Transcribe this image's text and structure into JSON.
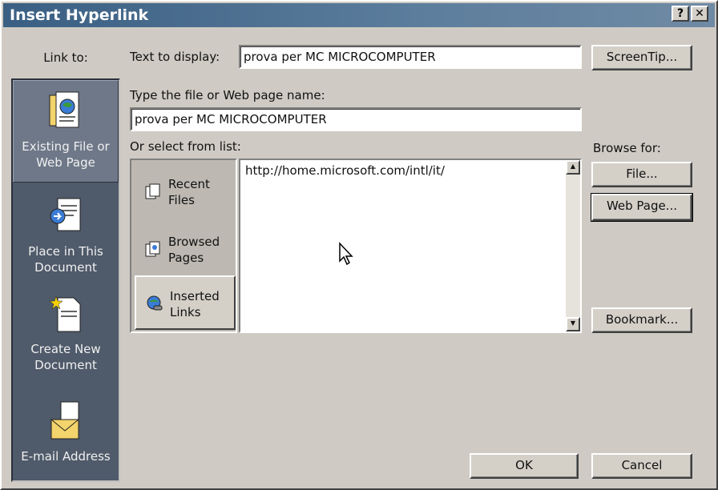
{
  "dialog": {
    "title": "Insert Hyperlink",
    "help_label": "?",
    "close_label": "✕"
  },
  "link_to": {
    "label": "Link to:",
    "places": [
      {
        "label_line1": "Existing File or",
        "label_line2": "Web Page",
        "icon": "existing-file-icon",
        "active": true
      },
      {
        "label_line1": "Place in This",
        "label_line2": "Document",
        "icon": "place-in-document-icon",
        "active": false
      },
      {
        "label_line1": "Create New",
        "label_line2": "Document",
        "icon": "create-new-document-icon",
        "active": false
      },
      {
        "label_line1": "E-mail Address",
        "label_line2": "",
        "icon": "email-icon",
        "active": false
      }
    ]
  },
  "text_to_display": {
    "label": "Text to display:",
    "value": "prova per MC MICROCOMPUTER"
  },
  "screentip_button": "ScreenTip...",
  "file_name": {
    "label": "Type the file or Web page name:",
    "value": "prova per MC MICROCOMPUTER"
  },
  "select_list": {
    "label": "Or select from list:",
    "frames": [
      {
        "line1": "Recent",
        "line2": "Files",
        "icon": "recent-files-icon",
        "selected": false
      },
      {
        "line1": "Browsed",
        "line2": "Pages",
        "icon": "browsed-pages-icon",
        "selected": false
      },
      {
        "line1": "Inserted",
        "line2": "Links",
        "icon": "inserted-links-icon",
        "selected": true
      }
    ],
    "items": [
      "http://home.microsoft.com/intl/it/"
    ]
  },
  "browse": {
    "label": "Browse for:",
    "file_button": "File...",
    "web_page_button": "Web Page..."
  },
  "bookmark_button": "Bookmark...",
  "ok_button": "OK",
  "cancel_button": "Cancel"
}
